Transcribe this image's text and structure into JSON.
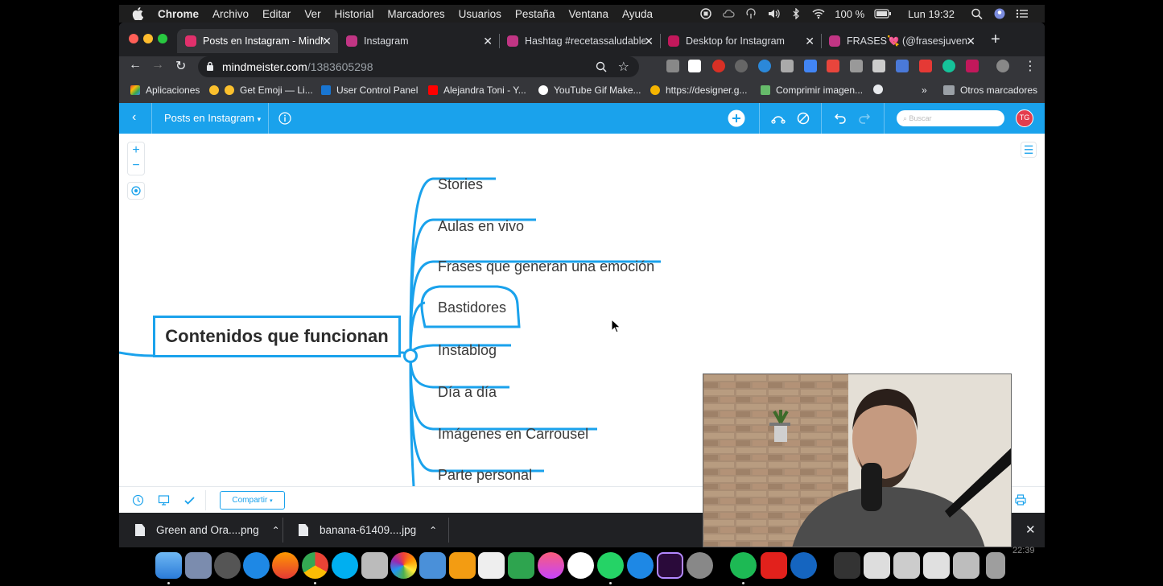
{
  "menubar": {
    "app": "Chrome",
    "menus": [
      "Archivo",
      "Editar",
      "Ver",
      "Historial",
      "Marcadores",
      "Usuarios",
      "Pestaña",
      "Ventana",
      "Ayuda"
    ],
    "battery": "100 %",
    "clock": "Lun 19:32"
  },
  "tabs": [
    {
      "title": "Posts en Instagram - MindM",
      "active": true,
      "favicon_color": "#e1306c"
    },
    {
      "title": "Instagram",
      "active": false,
      "favicon_color": "#c13584"
    },
    {
      "title": "Hashtag #recetassaludable",
      "active": false,
      "favicon_color": "#c13584"
    },
    {
      "title": "Desktop for Instagram",
      "active": false,
      "favicon_color": "#c2185b"
    },
    {
      "title": "FRASES💘 (@frasesjuvenil",
      "active": false,
      "favicon_color": "#c13584"
    }
  ],
  "omnibox": {
    "host": "mindmeister.com",
    "path": "/1383605298"
  },
  "bookmarks": [
    "Aplicaciones",
    "Get Emoji — Li...",
    "User Control Panel",
    "Alejandra Toni - Y...",
    "YouTube Gif Make...",
    "https://designer.g...",
    "Comprimir imagen...",
    "»",
    "Otros marcadores"
  ],
  "app": {
    "map_name": "Posts en Instagram",
    "search_placeholder": "Buscar",
    "avatar": "TG",
    "share_label": "Compartir"
  },
  "mindmap": {
    "root": "Contenidos que funcionan",
    "children": [
      "Stories",
      "Aulas en vivo",
      "Frases que generan una emoción",
      "Bastidores",
      "Instablog",
      "Día a día",
      "Imágenes en Carrousel",
      "Parte personal"
    ],
    "selected": "Bastidores"
  },
  "downloads": [
    "Green and Ora....png",
    "banana-61409....jpg"
  ],
  "dock_time": "22:39",
  "colors": {
    "accent": "#1aa2ec",
    "chrome_dark": "#202124",
    "chrome_mid": "#35363a"
  }
}
